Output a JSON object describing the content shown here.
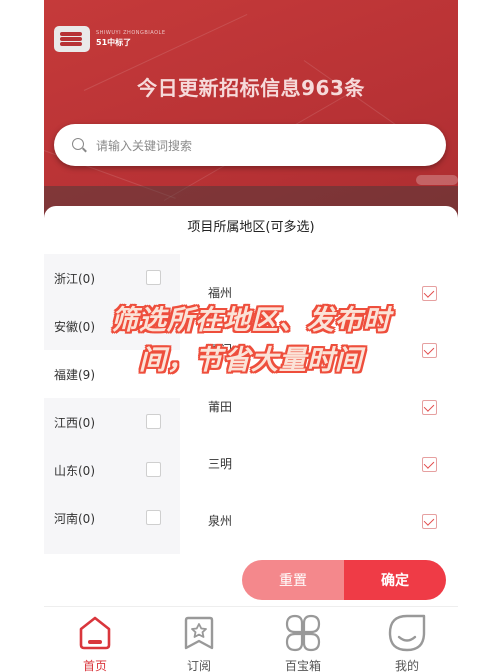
{
  "app": {
    "logo_small_text": "SHIWUYI ZHONGBIAOLE",
    "logo_name": "51中标了"
  },
  "banner": {
    "headline": "今日更新招标信息963条"
  },
  "search": {
    "placeholder": "请输入关键词搜索"
  },
  "filter": {
    "title": "项目所属地区(可多选)",
    "provinces": [
      {
        "label": "浙江(0)",
        "checked": false
      },
      {
        "label": "安徽(0)",
        "checked": false
      },
      {
        "label": "福建(9)",
        "checked": false,
        "selected": true
      },
      {
        "label": "江西(0)",
        "checked": false
      },
      {
        "label": "山东(0)",
        "checked": false
      },
      {
        "label": "河南(0)",
        "checked": false
      }
    ],
    "cities": [
      {
        "label": "福州",
        "checked": true
      },
      {
        "label": "厦门",
        "checked": true
      },
      {
        "label": "莆田",
        "checked": true
      },
      {
        "label": "三明",
        "checked": true
      },
      {
        "label": "泉州",
        "checked": true
      }
    ],
    "reset_label": "重置",
    "confirm_label": "确定"
  },
  "promo": {
    "line1": "筛选所在地区、发布时",
    "line2": "间，节省大量时间"
  },
  "tabs": [
    {
      "label": "首页",
      "icon": "home-icon",
      "active": true
    },
    {
      "label": "订阅",
      "icon": "subscribe-icon",
      "active": false
    },
    {
      "label": "百宝箱",
      "icon": "toolbox-icon",
      "active": false
    },
    {
      "label": "我的",
      "icon": "profile-icon",
      "active": false
    }
  ],
  "colors": {
    "brand_red": "#b83235",
    "accent_red": "#ef3b46",
    "reset_pink": "#f4888c",
    "check_red": "#e34b4b"
  }
}
